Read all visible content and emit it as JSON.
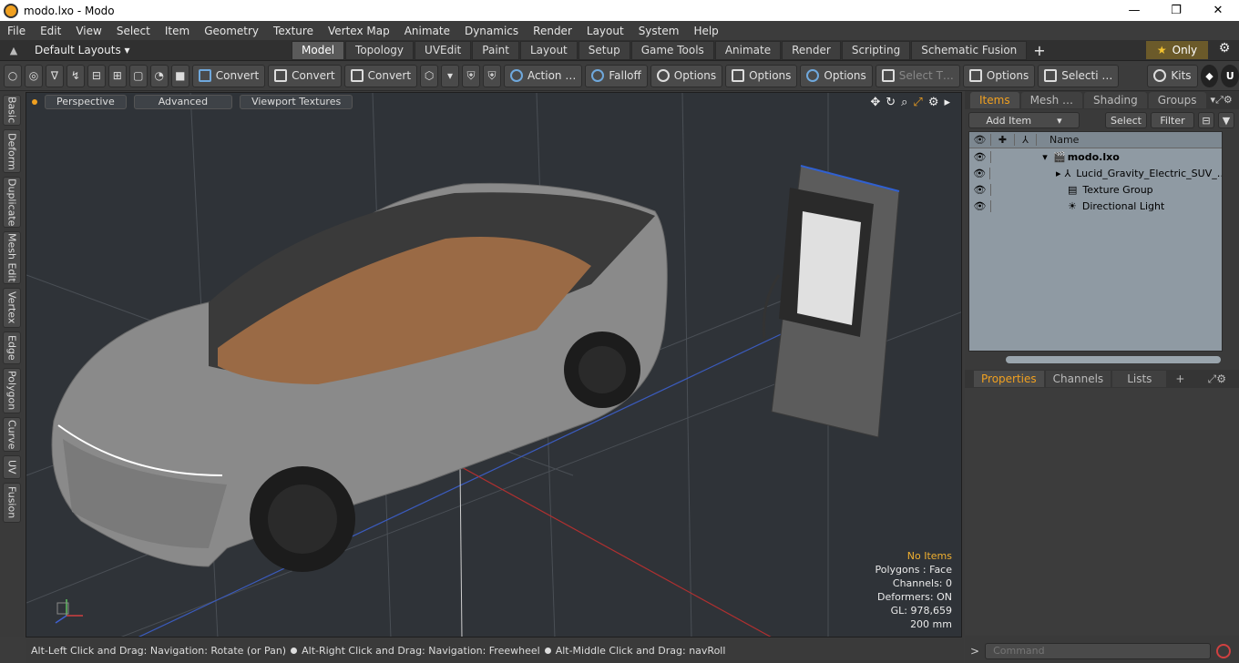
{
  "window": {
    "title": "modo.lxo - Modo",
    "minimize": "—",
    "maximize": "❐",
    "close": "✕"
  },
  "menu": [
    "File",
    "Edit",
    "View",
    "Select",
    "Item",
    "Geometry",
    "Texture",
    "Vertex Map",
    "Animate",
    "Dynamics",
    "Render",
    "Layout",
    "System",
    "Help"
  ],
  "layoutbar": {
    "default_layouts": "Default Layouts ▾",
    "tabs": [
      "Model",
      "Topology",
      "UVEdit",
      "Paint",
      "Layout",
      "Setup",
      "Game Tools",
      "Animate",
      "Render",
      "Scripting",
      "Schematic Fusion"
    ],
    "active_tab": "Model",
    "plus": "+",
    "only_label": "Only"
  },
  "toolbar": {
    "convert1": "Convert",
    "convert2": "Convert",
    "convert3": "Convert",
    "action": "Action …",
    "falloff": "Falloff",
    "options1": "Options",
    "options2": "Options",
    "options3": "Options",
    "select_t": "Select T…",
    "options4": "Options",
    "selecti": "Selecti …",
    "kits": "Kits"
  },
  "sidetabs": [
    "Basic",
    "Deform",
    "Duplicate",
    "Mesh Edit",
    "Vertex",
    "Edge",
    "Polygon",
    "Curve",
    "UV",
    "Fusion"
  ],
  "viewport": {
    "perspective": "Perspective",
    "advanced": "Advanced",
    "textures": "Viewport Textures",
    "stats": {
      "no_items": "No Items",
      "polygons": "Polygons : Face",
      "channels": "Channels: 0",
      "deformers": "Deformers: ON",
      "gl": "GL: 978,659",
      "scale": "200 mm"
    }
  },
  "status": {
    "part1": "Alt-Left Click and Drag: Navigation: Rotate (or Pan)",
    "part2": "Alt-Right Click and Drag: Navigation: Freewheel",
    "part3": "Alt-Middle Click and Drag: navRoll"
  },
  "items_panel": {
    "tabs": [
      "Items",
      "Mesh …",
      "Shading",
      "Groups"
    ],
    "add_item": "Add Item",
    "select": "Select",
    "filter": "Filter",
    "name_header": "Name",
    "rows": [
      {
        "name": "modo.lxo",
        "indent": 0
      },
      {
        "name": "Lucid_Gravity_Electric_SUV_…",
        "indent": 1
      },
      {
        "name": "Texture Group",
        "indent": 1
      },
      {
        "name": "Directional Light",
        "indent": 1
      }
    ]
  },
  "properties_panel": {
    "tabs": [
      "Properties",
      "Channels",
      "Lists"
    ],
    "plus": "+"
  },
  "command": {
    "prompt": ">",
    "placeholder": "Command"
  }
}
